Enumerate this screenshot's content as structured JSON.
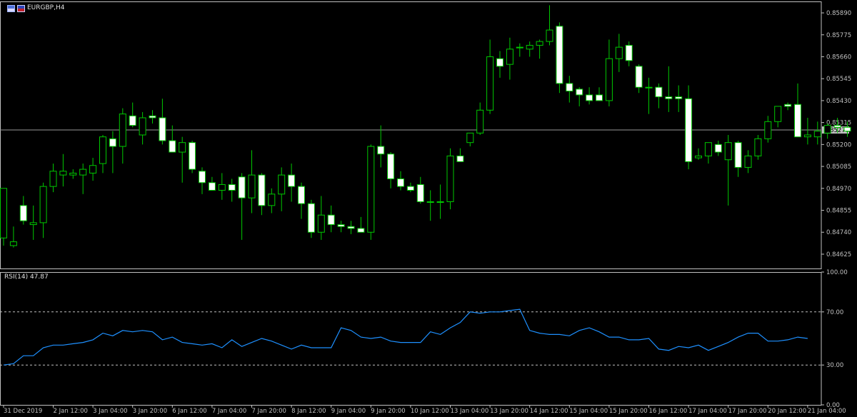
{
  "header": {
    "symbol_label": "EURGBP,H4",
    "indicator_label": "RSI(14) 47.87"
  },
  "icons": [
    "chart-window-icon",
    "flag-icon"
  ],
  "colors": {
    "background": "#000000",
    "bull_candle": "#00c800",
    "bear_candle": "#ffffff",
    "rsi_line": "#1e90ff",
    "grid_axis": "#c0c0c0",
    "current_price_badge": "#c0c0c0"
  },
  "chart_data": [
    {
      "type": "candlestick",
      "title": "EURGBP,H4",
      "xlabel": "",
      "ylabel": "",
      "ylim": [
        0.8455,
        0.8595
      ],
      "y_ticks": [
        "0.85890",
        "0.85775",
        "0.85660",
        "0.85545",
        "0.85430",
        "0.85315",
        "0.85200",
        "0.85085",
        "0.84970",
        "0.84855",
        "0.84740",
        "0.84625"
      ],
      "current_price": 0.85276,
      "current_price_label": "0.85276",
      "x_tick_labels": [
        {
          "label": "31 Dec 2019",
          "bar": 0
        },
        {
          "label": "2 Jan 12:00",
          "bar": 5
        },
        {
          "label": "3 Jan 04:00",
          "bar": 9
        },
        {
          "label": "3 Jan 20:00",
          "bar": 13
        },
        {
          "label": "6 Jan 12:00",
          "bar": 17
        },
        {
          "label": "7 Jan 04:00",
          "bar": 21
        },
        {
          "label": "7 Jan 20:00",
          "bar": 25
        },
        {
          "label": "8 Jan 12:00",
          "bar": 29
        },
        {
          "label": "9 Jan 04:00",
          "bar": 33
        },
        {
          "label": "9 Jan 20:00",
          "bar": 37
        },
        {
          "label": "10 Jan 12:00",
          "bar": 41
        },
        {
          "label": "13 Jan 04:00",
          "bar": 45
        },
        {
          "label": "13 Jan 20:00",
          "bar": 49
        },
        {
          "label": "14 Jan 12:00",
          "bar": 53
        },
        {
          "label": "15 Jan 04:00",
          "bar": 57
        },
        {
          "label": "15 Jan 20:00",
          "bar": 61
        },
        {
          "label": "16 Jan 12:00",
          "bar": 65
        },
        {
          "label": "17 Jan 04:00",
          "bar": 69
        },
        {
          "label": "17 Jan 20:00",
          "bar": 73
        },
        {
          "label": "20 Jan 12:00",
          "bar": 77
        },
        {
          "label": "21 Jan 04:00",
          "bar": 81
        }
      ],
      "candles": [
        {
          "o": 0.8471,
          "h": 0.849,
          "l": 0.8467,
          "c": 0.8497
        },
        {
          "o": 0.8467,
          "h": 0.8477,
          "l": 0.8466,
          "c": 0.8469
        },
        {
          "o": 0.8488,
          "h": 0.8493,
          "l": 0.8478,
          "c": 0.848
        },
        {
          "o": 0.8478,
          "h": 0.8488,
          "l": 0.847,
          "c": 0.8479
        },
        {
          "o": 0.8479,
          "h": 0.85,
          "l": 0.8471,
          "c": 0.8498
        },
        {
          "o": 0.8498,
          "h": 0.851,
          "l": 0.8495,
          "c": 0.8506
        },
        {
          "o": 0.8504,
          "h": 0.8515,
          "l": 0.8498,
          "c": 0.8506
        },
        {
          "o": 0.8504,
          "h": 0.8507,
          "l": 0.8502,
          "c": 0.8505
        },
        {
          "o": 0.8504,
          "h": 0.851,
          "l": 0.8494,
          "c": 0.8507
        },
        {
          "o": 0.8505,
          "h": 0.8513,
          "l": 0.8501,
          "c": 0.8509
        },
        {
          "o": 0.851,
          "h": 0.8525,
          "l": 0.8505,
          "c": 0.8524
        },
        {
          "o": 0.8523,
          "h": 0.8527,
          "l": 0.8505,
          "c": 0.8519
        },
        {
          "o": 0.8519,
          "h": 0.8539,
          "l": 0.851,
          "c": 0.8536
        },
        {
          "o": 0.8535,
          "h": 0.8542,
          "l": 0.8529,
          "c": 0.853
        },
        {
          "o": 0.8525,
          "h": 0.8537,
          "l": 0.852,
          "c": 0.8534
        },
        {
          "o": 0.8535,
          "h": 0.8538,
          "l": 0.8531,
          "c": 0.8534
        },
        {
          "o": 0.8534,
          "h": 0.8544,
          "l": 0.852,
          "c": 0.8522
        },
        {
          "o": 0.8522,
          "h": 0.853,
          "l": 0.852,
          "c": 0.8516
        },
        {
          "o": 0.8516,
          "h": 0.8524,
          "l": 0.85,
          "c": 0.8521
        },
        {
          "o": 0.8521,
          "h": 0.8522,
          "l": 0.8505,
          "c": 0.8507
        },
        {
          "o": 0.8506,
          "h": 0.8508,
          "l": 0.8494,
          "c": 0.85
        },
        {
          "o": 0.85,
          "h": 0.8503,
          "l": 0.8497,
          "c": 0.8496
        },
        {
          "o": 0.8496,
          "h": 0.8505,
          "l": 0.8491,
          "c": 0.8499
        },
        {
          "o": 0.8499,
          "h": 0.8502,
          "l": 0.849,
          "c": 0.8496
        },
        {
          "o": 0.8503,
          "h": 0.8505,
          "l": 0.847,
          "c": 0.8492
        },
        {
          "o": 0.8492,
          "h": 0.8517,
          "l": 0.8484,
          "c": 0.8504
        },
        {
          "o": 0.8504,
          "h": 0.8505,
          "l": 0.8483,
          "c": 0.8488
        },
        {
          "o": 0.8488,
          "h": 0.8497,
          "l": 0.8484,
          "c": 0.8494
        },
        {
          "o": 0.8494,
          "h": 0.8508,
          "l": 0.8485,
          "c": 0.8504
        },
        {
          "o": 0.8504,
          "h": 0.851,
          "l": 0.849,
          "c": 0.8498
        },
        {
          "o": 0.8498,
          "h": 0.85,
          "l": 0.8481,
          "c": 0.8489
        },
        {
          "o": 0.8489,
          "h": 0.8491,
          "l": 0.8471,
          "c": 0.8474
        },
        {
          "o": 0.8474,
          "h": 0.8493,
          "l": 0.847,
          "c": 0.8483
        },
        {
          "o": 0.8483,
          "h": 0.8488,
          "l": 0.8474,
          "c": 0.8478
        },
        {
          "o": 0.8478,
          "h": 0.848,
          "l": 0.8474,
          "c": 0.8477
        },
        {
          "o": 0.8477,
          "h": 0.848,
          "l": 0.8473,
          "c": 0.8476
        },
        {
          "o": 0.8476,
          "h": 0.8482,
          "l": 0.8474,
          "c": 0.8474
        },
        {
          "o": 0.8474,
          "h": 0.852,
          "l": 0.847,
          "c": 0.8519
        },
        {
          "o": 0.8519,
          "h": 0.853,
          "l": 0.8508,
          "c": 0.8515
        },
        {
          "o": 0.8515,
          "h": 0.8516,
          "l": 0.8497,
          "c": 0.8502
        },
        {
          "o": 0.8502,
          "h": 0.8506,
          "l": 0.8496,
          "c": 0.8498
        },
        {
          "o": 0.8498,
          "h": 0.85,
          "l": 0.8495,
          "c": 0.8496
        },
        {
          "o": 0.8499,
          "h": 0.8503,
          "l": 0.8489,
          "c": 0.849
        },
        {
          "o": 0.849,
          "h": 0.8496,
          "l": 0.848,
          "c": 0.849
        },
        {
          "o": 0.849,
          "h": 0.8499,
          "l": 0.8481,
          "c": 0.849
        },
        {
          "o": 0.849,
          "h": 0.8518,
          "l": 0.8486,
          "c": 0.8514
        },
        {
          "o": 0.8514,
          "h": 0.8518,
          "l": 0.8512,
          "c": 0.8511
        },
        {
          "o": 0.8521,
          "h": 0.8526,
          "l": 0.8519,
          "c": 0.8526
        },
        {
          "o": 0.8526,
          "h": 0.8542,
          "l": 0.8525,
          "c": 0.8538
        },
        {
          "o": 0.8538,
          "h": 0.8575,
          "l": 0.8536,
          "c": 0.8566
        },
        {
          "o": 0.8565,
          "h": 0.8569,
          "l": 0.8555,
          "c": 0.8561
        },
        {
          "o": 0.8562,
          "h": 0.8576,
          "l": 0.8554,
          "c": 0.857
        },
        {
          "o": 0.8571,
          "h": 0.8573,
          "l": 0.8566,
          "c": 0.8571
        },
        {
          "o": 0.857,
          "h": 0.8574,
          "l": 0.8566,
          "c": 0.8572
        },
        {
          "o": 0.8572,
          "h": 0.8575,
          "l": 0.8565,
          "c": 0.8574
        },
        {
          "o": 0.8574,
          "h": 0.8593,
          "l": 0.8572,
          "c": 0.858
        },
        {
          "o": 0.8582,
          "h": 0.8584,
          "l": 0.8547,
          "c": 0.8552
        },
        {
          "o": 0.8552,
          "h": 0.8556,
          "l": 0.8542,
          "c": 0.8548
        },
        {
          "o": 0.8549,
          "h": 0.855,
          "l": 0.854,
          "c": 0.8546
        },
        {
          "o": 0.8546,
          "h": 0.855,
          "l": 0.8541,
          "c": 0.8543
        },
        {
          "o": 0.8546,
          "h": 0.855,
          "l": 0.8543,
          "c": 0.8543
        },
        {
          "o": 0.8543,
          "h": 0.8575,
          "l": 0.854,
          "c": 0.8565
        },
        {
          "o": 0.8565,
          "h": 0.8578,
          "l": 0.8558,
          "c": 0.8571
        },
        {
          "o": 0.8572,
          "h": 0.8574,
          "l": 0.8561,
          "c": 0.8564
        },
        {
          "o": 0.8561,
          "h": 0.8562,
          "l": 0.8547,
          "c": 0.855
        },
        {
          "o": 0.855,
          "h": 0.8555,
          "l": 0.8536,
          "c": 0.855
        },
        {
          "o": 0.855,
          "h": 0.8552,
          "l": 0.8539,
          "c": 0.8545
        },
        {
          "o": 0.8545,
          "h": 0.8561,
          "l": 0.8537,
          "c": 0.8544
        },
        {
          "o": 0.8545,
          "h": 0.8551,
          "l": 0.8537,
          "c": 0.8544
        },
        {
          "o": 0.8544,
          "h": 0.8551,
          "l": 0.8507,
          "c": 0.8511
        },
        {
          "o": 0.8513,
          "h": 0.8518,
          "l": 0.8512,
          "c": 0.8514
        },
        {
          "o": 0.8514,
          "h": 0.8521,
          "l": 0.851,
          "c": 0.8521
        },
        {
          "o": 0.852,
          "h": 0.8522,
          "l": 0.8514,
          "c": 0.8516
        },
        {
          "o": 0.8512,
          "h": 0.8525,
          "l": 0.8488,
          "c": 0.8521
        },
        {
          "o": 0.8521,
          "h": 0.8522,
          "l": 0.8503,
          "c": 0.8508
        },
        {
          "o": 0.8508,
          "h": 0.8517,
          "l": 0.8505,
          "c": 0.8514
        },
        {
          "o": 0.8514,
          "h": 0.8525,
          "l": 0.8512,
          "c": 0.8523
        },
        {
          "o": 0.8523,
          "h": 0.8535,
          "l": 0.8521,
          "c": 0.8532
        },
        {
          "o": 0.8532,
          "h": 0.854,
          "l": 0.8529,
          "c": 0.854
        },
        {
          "o": 0.8541,
          "h": 0.8542,
          "l": 0.8538,
          "c": 0.854
        },
        {
          "o": 0.8541,
          "h": 0.8552,
          "l": 0.8537,
          "c": 0.8524
        },
        {
          "o": 0.8524,
          "h": 0.8534,
          "l": 0.852,
          "c": 0.8525
        },
        {
          "o": 0.8524,
          "h": 0.8532,
          "l": 0.852,
          "c": 0.8527
        },
        {
          "o": 0.8526,
          "h": 0.8531,
          "l": 0.8523,
          "c": 0.853
        },
        {
          "o": 0.853,
          "h": 0.8534,
          "l": 0.8526,
          "c": 0.8529
        },
        {
          "o": 0.8529,
          "h": 0.8532,
          "l": 0.8524,
          "c": 0.8527
        }
      ]
    },
    {
      "type": "line",
      "title": "RSI(14) 47.87",
      "ylim": [
        0,
        100
      ],
      "y_ticks": [
        "100.00",
        "70.00",
        "30.00",
        "0.00"
      ],
      "levels": [
        70,
        30
      ],
      "series": [
        {
          "values": [
            30,
            31,
            37,
            37,
            43,
            45,
            45,
            46,
            47,
            49,
            54,
            52,
            56,
            55,
            56,
            55,
            49,
            51,
            47,
            46,
            45,
            46,
            43,
            49,
            44,
            47,
            50,
            48,
            45,
            42,
            45,
            43,
            43,
            43,
            58,
            56,
            51,
            50,
            51,
            48,
            47,
            47,
            47,
            55,
            53,
            58,
            62,
            70,
            69,
            70,
            70,
            71,
            72,
            56,
            54,
            53,
            53,
            52,
            56,
            58,
            55,
            51,
            51,
            49,
            49,
            50,
            42,
            41,
            44,
            43,
            45,
            41,
            44,
            47,
            51,
            54,
            54,
            48,
            48,
            49,
            51,
            50
          ]
        }
      ]
    }
  ]
}
